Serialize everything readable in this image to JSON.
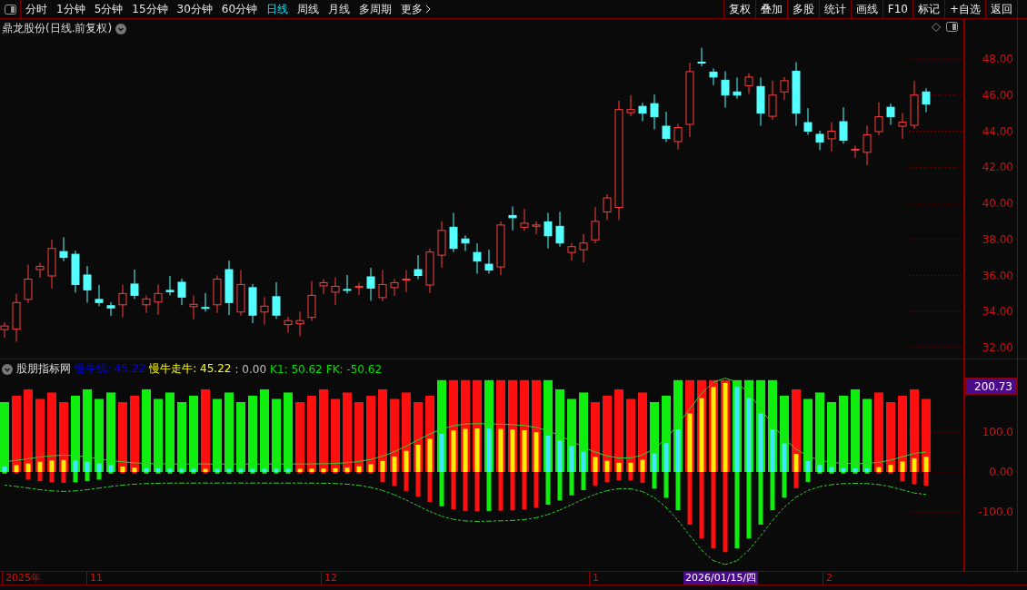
{
  "toolbar": {
    "periods": [
      {
        "label": "分时",
        "selected": false
      },
      {
        "label": "1分钟",
        "selected": false
      },
      {
        "label": "5分钟",
        "selected": false
      },
      {
        "label": "15分钟",
        "selected": false
      },
      {
        "label": "30分钟",
        "selected": false
      },
      {
        "label": "60分钟",
        "selected": false
      },
      {
        "label": "日线",
        "selected": true
      },
      {
        "label": "周线",
        "selected": false
      },
      {
        "label": "月线",
        "selected": false
      },
      {
        "label": "多周期",
        "selected": false
      },
      {
        "label": "更多",
        "selected": false
      }
    ],
    "buttons": [
      "复权",
      "叠加",
      "多股",
      "统计",
      "画线",
      "F10",
      "标记",
      "+自选",
      "返回"
    ]
  },
  "chart_title": "鼎龙股份(日线.前复权)",
  "price_axis": [
    "48.00",
    "46.00",
    "44.00",
    "42.00",
    "40.00",
    "38.00",
    "36.00",
    "34.00",
    "32.00"
  ],
  "indicator": {
    "name": "股朋指标网",
    "readouts": [
      {
        "text": "慢牛线: 45.22",
        "color": "#0000ff"
      },
      {
        "text": "慢牛走牛: 45.22",
        "color": "#ffff00"
      },
      {
        "text": ": 0.00",
        "color": "#c0c0c0"
      },
      {
        "text": "K1: 50.62",
        "color": "#00e000"
      },
      {
        "text": "FK: -50.62",
        "color": "#00e000"
      }
    ]
  },
  "indicator_axis": {
    "badge": "200.73",
    "ticks": [
      "100.0",
      "0.00",
      "-100.0"
    ]
  },
  "date_axis": {
    "labels": [
      "2025年",
      "11",
      "12",
      "1",
      "2"
    ],
    "crosshair_date": "2026/01/15/四"
  }
}
